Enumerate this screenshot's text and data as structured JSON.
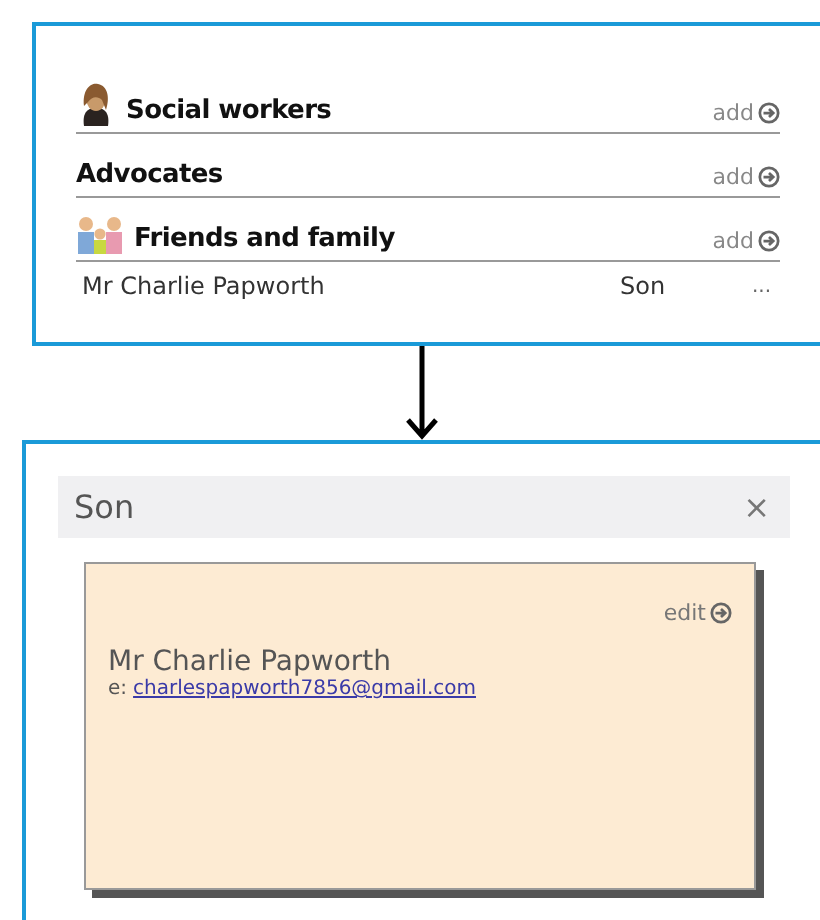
{
  "groups": [
    {
      "kind": "person",
      "title": "Social workers",
      "action": "add"
    },
    {
      "kind": "plain",
      "title": "Advocates",
      "action": "add"
    },
    {
      "kind": "family",
      "title": "Friends and family",
      "action": "add",
      "contacts": [
        {
          "name": "Mr Charlie Papworth",
          "relation": "Son",
          "more": "..."
        }
      ]
    }
  ],
  "dialog": {
    "title": "Son",
    "close": "×",
    "card": {
      "action": "edit",
      "name": "Mr Charlie Papworth",
      "email_prefix": "e:",
      "email": "charlespapworth7856@gmail.com"
    }
  }
}
